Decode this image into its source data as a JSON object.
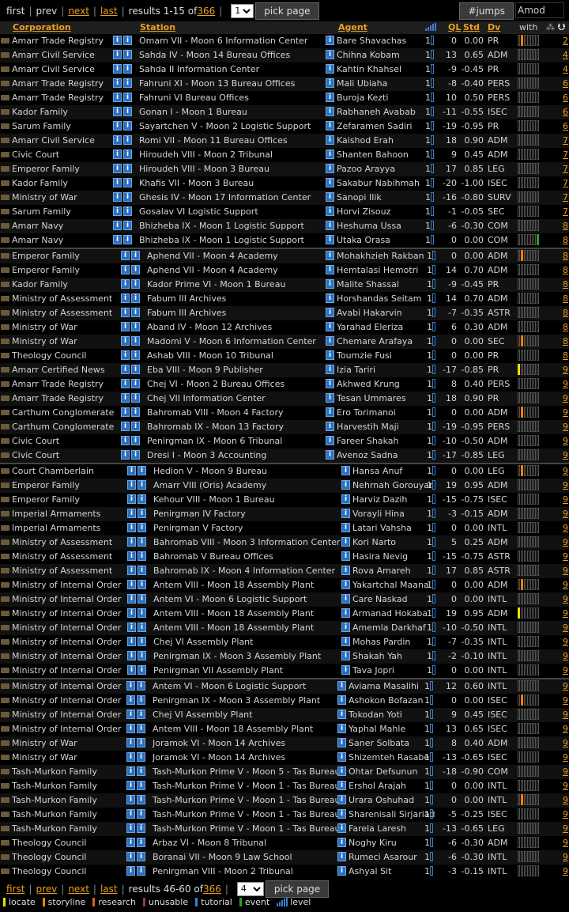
{
  "nav_top": {
    "first": "first",
    "prev": "prev",
    "next": "next",
    "last": "last",
    "results_prefix": "results 1-15 of ",
    "results_total": "366",
    "page_value": "1",
    "pick_page": "pick page",
    "jumps_button": "#jumps",
    "jumps_value": "Amod"
  },
  "nav_bottom": {
    "first": "first",
    "prev": "prev",
    "next": "next",
    "last": "last",
    "results_prefix": "results 46-60 of ",
    "results_total": "366",
    "page_value": "4",
    "pick_page": "pick page"
  },
  "columns": {
    "corporation": "Corporation",
    "station": "Station",
    "agent": "Agent",
    "ql": "QL",
    "std": "Std",
    "dv": "Dv",
    "with": "with"
  },
  "rows": [
    {
      "corp": "Amarr Trade Registry",
      "station": "Omam VII - Moon 6 Information Center",
      "agent": "Bare Shavachas",
      "lvl": "1",
      "ql": "0",
      "std": "0.00",
      "dv": "PR",
      "bar": "o",
      "last": "2"
    },
    {
      "corp": "Amarr Civil Service",
      "station": "Sahda IV - Moon 14 Bureau Offices",
      "agent": "Chihna Kobam",
      "lvl": "1",
      "ql": "13",
      "std": "0.65",
      "dv": "ADM",
      "bar": "",
      "last": "4"
    },
    {
      "corp": "Amarr Civil Service",
      "station": "Sahda II Information Center",
      "agent": "Kahtin Khahsel",
      "lvl": "1",
      "ql": "-9",
      "std": "-0.45",
      "dv": "PR",
      "bar": "",
      "last": "4"
    },
    {
      "corp": "Amarr Trade Registry",
      "station": "Fahruni XI - Moon 13 Bureau Offices",
      "agent": "Mali Ubiaha",
      "lvl": "1",
      "ql": "-8",
      "std": "-0.40",
      "dv": "PERS",
      "bar": "",
      "last": "6"
    },
    {
      "corp": "Amarr Trade Registry",
      "station": "Fahruni VI Bureau Offices",
      "agent": "Buroja Kezti",
      "lvl": "1",
      "ql": "10",
      "std": "0.50",
      "dv": "PERS",
      "bar": "",
      "last": "6"
    },
    {
      "corp": "Kador Family",
      "station": "Gonan I - Moon 1 Bureau",
      "agent": "Rabhaneh Avabab",
      "lvl": "1",
      "ql": "-11",
      "std": "-0.55",
      "dv": "ISEC",
      "bar": "",
      "last": "6"
    },
    {
      "corp": "Sarum Family",
      "station": "Sayartchen V - Moon 2 Logistic Support",
      "agent": "Zefaramen Sadiri",
      "lvl": "1",
      "ql": "-19",
      "std": "-0.95",
      "dv": "PR",
      "bar": "",
      "last": "6"
    },
    {
      "corp": "Amarr Civil Service",
      "station": "Romi VII - Moon 11 Bureau Offices",
      "agent": "Kaishod Erah",
      "lvl": "1",
      "ql": "18",
      "std": "0.90",
      "dv": "ADM",
      "bar": "",
      "last": "7"
    },
    {
      "corp": "Civic Court",
      "station": "Hiroudeh VIII - Moon 2 Tribunal",
      "agent": "Shanten Bahoon",
      "lvl": "1",
      "ql": "9",
      "std": "0.45",
      "dv": "ADM",
      "bar": "",
      "last": "7"
    },
    {
      "corp": "Emperor Family",
      "station": "Hiroudeh VIII - Moon 3 Bureau",
      "agent": "Pazoo Arayya",
      "lvl": "1",
      "ql": "17",
      "std": "0.85",
      "dv": "LEG",
      "bar": "",
      "last": "7"
    },
    {
      "corp": "Kador Family",
      "station": "Khafis VII - Moon 3 Bureau",
      "agent": "Sakabur Nabihmah",
      "lvl": "1",
      "ql": "-20",
      "std": "-1.00",
      "dv": "ISEC",
      "bar": "",
      "last": "7"
    },
    {
      "corp": "Ministry of War",
      "station": "Ghesis IV - Moon 17 Information Center",
      "agent": "Sanopi Ilik",
      "lvl": "1",
      "ql": "-16",
      "std": "-0.80",
      "dv": "SURV",
      "bar": "",
      "last": "7"
    },
    {
      "corp": "Sarum Family",
      "station": "Gosalav VI Logistic Support",
      "agent": "Horvi Zisouz",
      "lvl": "1",
      "ql": "-1",
      "std": "-0.05",
      "dv": "SEC",
      "bar": "",
      "last": "7"
    },
    {
      "corp": "Amarr Navy",
      "station": "Bhizheba IX - Moon 1 Logistic Support",
      "agent": "Heshuma Ussa",
      "lvl": "1",
      "ql": "-6",
      "std": "-0.30",
      "dv": "COM",
      "bar": "",
      "last": "8"
    },
    {
      "corp": "Amarr Navy",
      "station": "Bhizheba IX - Moon 1 Logistic Support",
      "agent": "Utaka Orasa",
      "lvl": "1",
      "ql": "0",
      "std": "0.00",
      "dv": "COM",
      "bar": "g",
      "last": "8"
    },
    {
      "corp": "Emperor Family",
      "station": "Aphend VII - Moon 4 Academy",
      "agent": "Mohakhzieh Rakban",
      "lvl": "1",
      "ql": "0",
      "std": "0.00",
      "dv": "ADM",
      "bar": "o",
      "last": "8",
      "sep": true
    },
    {
      "corp": "Emperor Family",
      "station": "Aphend VII - Moon 4 Academy",
      "agent": "Hemtalasi Hemotri",
      "lvl": "1",
      "ql": "14",
      "std": "0.70",
      "dv": "ADM",
      "bar": "",
      "last": "8"
    },
    {
      "corp": "Kador Family",
      "station": "Kador Prime VI - Moon 1 Bureau",
      "agent": "Malite Shassal",
      "lvl": "1",
      "ql": "-9",
      "std": "-0.45",
      "dv": "PR",
      "bar": "",
      "last": "8"
    },
    {
      "corp": "Ministry of Assessment",
      "station": "Fabum III Archives",
      "agent": "Horshandas Seitam",
      "lvl": "1",
      "ql": "14",
      "std": "0.70",
      "dv": "ADM",
      "bar": "",
      "last": "8"
    },
    {
      "corp": "Ministry of Assessment",
      "station": "Fabum III Archives",
      "agent": "Avabi Hakarvin",
      "lvl": "1",
      "ql": "-7",
      "std": "-0.35",
      "dv": "ASTR",
      "bar": "",
      "last": "8"
    },
    {
      "corp": "Ministry of War",
      "station": "Aband IV - Moon 12 Archives",
      "agent": "Yarahad Eleriza",
      "lvl": "1",
      "ql": "6",
      "std": "0.30",
      "dv": "ADM",
      "bar": "",
      "last": "8"
    },
    {
      "corp": "Ministry of War",
      "station": "Madomi V - Moon 6 Information Center",
      "agent": "Chemare Arafaya",
      "lvl": "1",
      "ql": "0",
      "std": "0.00",
      "dv": "SEC",
      "bar": "o",
      "last": "8"
    },
    {
      "corp": "Theology Council",
      "station": "Ashab VIII - Moon 10 Tribunal",
      "agent": "Toumzie Fusi",
      "lvl": "1",
      "ql": "0",
      "std": "0.00",
      "dv": "PR",
      "bar": "",
      "last": "8"
    },
    {
      "corp": "Amarr Certified News",
      "station": "Eba VIII - Moon 9 Publisher",
      "agent": "Izia Tariri",
      "lvl": "1",
      "ql": "-17",
      "std": "-0.85",
      "dv": "PR",
      "bar": "y",
      "last": "9"
    },
    {
      "corp": "Amarr Trade Registry",
      "station": "Chej VI - Moon 2 Bureau Offices",
      "agent": "Akhwed Krung",
      "lvl": "1",
      "ql": "8",
      "std": "0.40",
      "dv": "PERS",
      "bar": "",
      "last": "9"
    },
    {
      "corp": "Amarr Trade Registry",
      "station": "Chej VII Information Center",
      "agent": "Tesan Ummares",
      "lvl": "1",
      "ql": "18",
      "std": "0.90",
      "dv": "PR",
      "bar": "",
      "last": "9"
    },
    {
      "corp": "Carthum Conglomerate",
      "station": "Bahromab VIII - Moon 4 Factory",
      "agent": "Ero Torimanoi",
      "lvl": "1",
      "ql": "0",
      "std": "0.00",
      "dv": "ADM",
      "bar": "o",
      "last": "9"
    },
    {
      "corp": "Carthum Conglomerate",
      "station": "Bahromab IX - Moon 13 Factory",
      "agent": "Harvestih Maji",
      "lvl": "1",
      "ql": "-19",
      "std": "-0.95",
      "dv": "PERS",
      "bar": "",
      "last": "9"
    },
    {
      "corp": "Civic Court",
      "station": "Penirgman IX - Moon 6 Tribunal",
      "agent": "Fareer Shakah",
      "lvl": "1",
      "ql": "-10",
      "std": "-0.50",
      "dv": "ADM",
      "bar": "",
      "last": "9"
    },
    {
      "corp": "Civic Court",
      "station": "Dresi I - Moon 3 Accounting",
      "agent": "Avenoz Sadna",
      "lvl": "1",
      "ql": "-17",
      "std": "-0.85",
      "dv": "LEG",
      "bar": "",
      "last": "9"
    },
    {
      "corp": "Court Chamberlain",
      "station": "Hedion V - Moon 9 Bureau",
      "agent": "Hansa Anuf",
      "lvl": "1",
      "ql": "0",
      "std": "0.00",
      "dv": "LEG",
      "bar": "o",
      "last": "9",
      "sep": true
    },
    {
      "corp": "Emperor Family",
      "station": "Amarr VIII (Oris) Academy",
      "agent": "Nehrnah Gorouyar",
      "lvl": "1",
      "ql": "19",
      "std": "0.95",
      "dv": "ADM",
      "bar": "",
      "last": "9"
    },
    {
      "corp": "Emperor Family",
      "station": "Kehour VIII - Moon 1 Bureau",
      "agent": "Harviz Dazih",
      "lvl": "1",
      "ql": "-15",
      "std": "-0.75",
      "dv": "ISEC",
      "bar": "",
      "last": "9"
    },
    {
      "corp": "Imperial Armaments",
      "station": "Penirgman IV Factory",
      "agent": "Vorayli Hina",
      "lvl": "1",
      "ql": "-3",
      "std": "-0.15",
      "dv": "ADM",
      "bar": "",
      "last": "9"
    },
    {
      "corp": "Imperial Armaments",
      "station": "Penirgman V Factory",
      "agent": "Latari Vahsha",
      "lvl": "1",
      "ql": "0",
      "std": "0.00",
      "dv": "INTL",
      "bar": "",
      "last": "9"
    },
    {
      "corp": "Ministry of Assessment",
      "station": "Bahromab VIII - Moon 3 Information Center",
      "agent": "Kori Narto",
      "lvl": "1",
      "ql": "5",
      "std": "0.25",
      "dv": "ADM",
      "bar": "",
      "last": "9"
    },
    {
      "corp": "Ministry of Assessment",
      "station": "Bahromab V Bureau Offices",
      "agent": "Hasira Nevig",
      "lvl": "1",
      "ql": "-15",
      "std": "-0.75",
      "dv": "ASTR",
      "bar": "",
      "last": "9"
    },
    {
      "corp": "Ministry of Assessment",
      "station": "Bahromab IX - Moon 4 Information Center",
      "agent": "Rova Amareh",
      "lvl": "1",
      "ql": "17",
      "std": "0.85",
      "dv": "ASTR",
      "bar": "",
      "last": "9"
    },
    {
      "corp": "Ministry of Internal Order",
      "station": "Antem VIII - Moon 18 Assembly Plant",
      "agent": "Yakartchal Maana",
      "lvl": "1",
      "ql": "0",
      "std": "0.00",
      "dv": "ADM",
      "bar": "o",
      "last": "9"
    },
    {
      "corp": "Ministry of Internal Order",
      "station": "Antem VI - Moon 6 Logistic Support",
      "agent": "Care Naskad",
      "lvl": "1",
      "ql": "0",
      "std": "0.00",
      "dv": "INTL",
      "bar": "",
      "last": "9"
    },
    {
      "corp": "Ministry of Internal Order",
      "station": "Antem VIII - Moon 18 Assembly Plant",
      "agent": "Armanad Hokaba",
      "lvl": "1",
      "ql": "19",
      "std": "0.95",
      "dv": "ADM",
      "bar": "y",
      "last": "9"
    },
    {
      "corp": "Ministry of Internal Order",
      "station": "Antem VIII - Moon 18 Assembly Plant",
      "agent": "Amemla Darkhaf",
      "lvl": "1",
      "ql": "-10",
      "std": "-0.50",
      "dv": "INTL",
      "bar": "",
      "last": "9"
    },
    {
      "corp": "Ministry of Internal Order",
      "station": "Chej VI Assembly Plant",
      "agent": "Mohas Pardin",
      "lvl": "1",
      "ql": "-7",
      "std": "-0.35",
      "dv": "INTL",
      "bar": "",
      "last": "9"
    },
    {
      "corp": "Ministry of Internal Order",
      "station": "Penirgman IX - Moon 3 Assembly Plant",
      "agent": "Shakah Yah",
      "lvl": "1",
      "ql": "-2",
      "std": "-0.10",
      "dv": "INTL",
      "bar": "",
      "last": "9"
    },
    {
      "corp": "Ministry of Internal Order",
      "station": "Penirgman VII Assembly Plant",
      "agent": "Tava Jopri",
      "lvl": "1",
      "ql": "0",
      "std": "0.00",
      "dv": "INTL",
      "bar": "",
      "last": "9"
    },
    {
      "corp": "Ministry of Internal Order",
      "station": "Antem VI - Moon 6 Logistic Support",
      "agent": "Aviama Masalihi",
      "lvl": "1",
      "ql": "12",
      "std": "0.60",
      "dv": "INTL",
      "bar": "",
      "last": "9",
      "sep": true
    },
    {
      "corp": "Ministry of Internal Order",
      "station": "Penirgman IX - Moon 3 Assembly Plant",
      "agent": "Ashokon Bofazan",
      "lvl": "1",
      "ql": "0",
      "std": "0.00",
      "dv": "ISEC",
      "bar": "o",
      "last": "9"
    },
    {
      "corp": "Ministry of Internal Order",
      "station": "Chej VI Assembly Plant",
      "agent": "Tokodan Yoti",
      "lvl": "1",
      "ql": "9",
      "std": "0.45",
      "dv": "ISEC",
      "bar": "",
      "last": "9"
    },
    {
      "corp": "Ministry of Internal Order",
      "station": "Antem VIII - Moon 18 Assembly Plant",
      "agent": "Yaphal Mahle",
      "lvl": "1",
      "ql": "13",
      "std": "0.65",
      "dv": "ISEC",
      "bar": "",
      "last": "9"
    },
    {
      "corp": "Ministry of War",
      "station": "Joramok VI - Moon 14 Archives",
      "agent": "Saner Solbata",
      "lvl": "1",
      "ql": "8",
      "std": "0.40",
      "dv": "ADM",
      "bar": "",
      "last": "9"
    },
    {
      "corp": "Ministry of War",
      "station": "Joramok VI - Moon 14 Archives",
      "agent": "Shizemteh Rasabe",
      "lvl": "1",
      "ql": "-13",
      "std": "-0.65",
      "dv": "ISEC",
      "bar": "",
      "last": "9"
    },
    {
      "corp": "Tash-Murkon Family",
      "station": "Tash-Murkon Prime V - Moon 5 - Tas Bureau",
      "agent": "Ohtar Defsunun",
      "lvl": "1",
      "ql": "-18",
      "std": "-0.90",
      "dv": "COM",
      "bar": "",
      "last": "9"
    },
    {
      "corp": "Tash-Murkon Family",
      "station": "Tash-Murkon Prime V - Moon 1 - Tas Bureau",
      "agent": "Ershol Arajah",
      "lvl": "1",
      "ql": "0",
      "std": "0.00",
      "dv": "INTL",
      "bar": "",
      "last": "9"
    },
    {
      "corp": "Tash-Murkon Family",
      "station": "Tash-Murkon Prime V - Moon 1 - Tas Bureau",
      "agent": "Urara Oshuhad",
      "lvl": "1",
      "ql": "0",
      "std": "0.00",
      "dv": "INTL",
      "bar": "o",
      "last": "9"
    },
    {
      "corp": "Tash-Murkon Family",
      "station": "Tash-Murkon Prime V - Moon 1 - Tas Bureau",
      "agent": "Sharenisali Sirjariad",
      "lvl": "1",
      "ql": "-5",
      "std": "-0.25",
      "dv": "ISEC",
      "bar": "",
      "last": "9"
    },
    {
      "corp": "Tash-Murkon Family",
      "station": "Tash-Murkon Prime V - Moon 1 - Tas Bureau",
      "agent": "Farela Laresh",
      "lvl": "1",
      "ql": "-13",
      "std": "-0.65",
      "dv": "LEG",
      "bar": "",
      "last": "9"
    },
    {
      "corp": "Theology Council",
      "station": "Arbaz VI - Moon 8 Tribunal",
      "agent": "Noghy Kiru",
      "lvl": "1",
      "ql": "-6",
      "std": "-0.30",
      "dv": "ADM",
      "bar": "",
      "last": "9"
    },
    {
      "corp": "Theology Council",
      "station": "Boranai VII - Moon 9 Law School",
      "agent": "Rumeci Asarour",
      "lvl": "1",
      "ql": "-6",
      "std": "-0.30",
      "dv": "INTL",
      "bar": "",
      "last": "9"
    },
    {
      "corp": "Theology Council",
      "station": "Penirgman VIII - Moon 2 Tribunal",
      "agent": "Ashyal Sit",
      "lvl": "1",
      "ql": "-3",
      "std": "-0.15",
      "dv": "INTL",
      "bar": "",
      "last": "9"
    }
  ],
  "legend": [
    {
      "label": "locate",
      "color": "#f0e000"
    },
    {
      "label": "storyline",
      "color": "#f08000"
    },
    {
      "label": "research",
      "color": "#e06020"
    },
    {
      "label": "unusable",
      "color": "#a0306a"
    },
    {
      "label": "tutorial",
      "color": "#3a7fd0"
    },
    {
      "label": "event",
      "color": "#2aa02a"
    },
    {
      "label": "level",
      "color": "#3a7fd0"
    }
  ]
}
